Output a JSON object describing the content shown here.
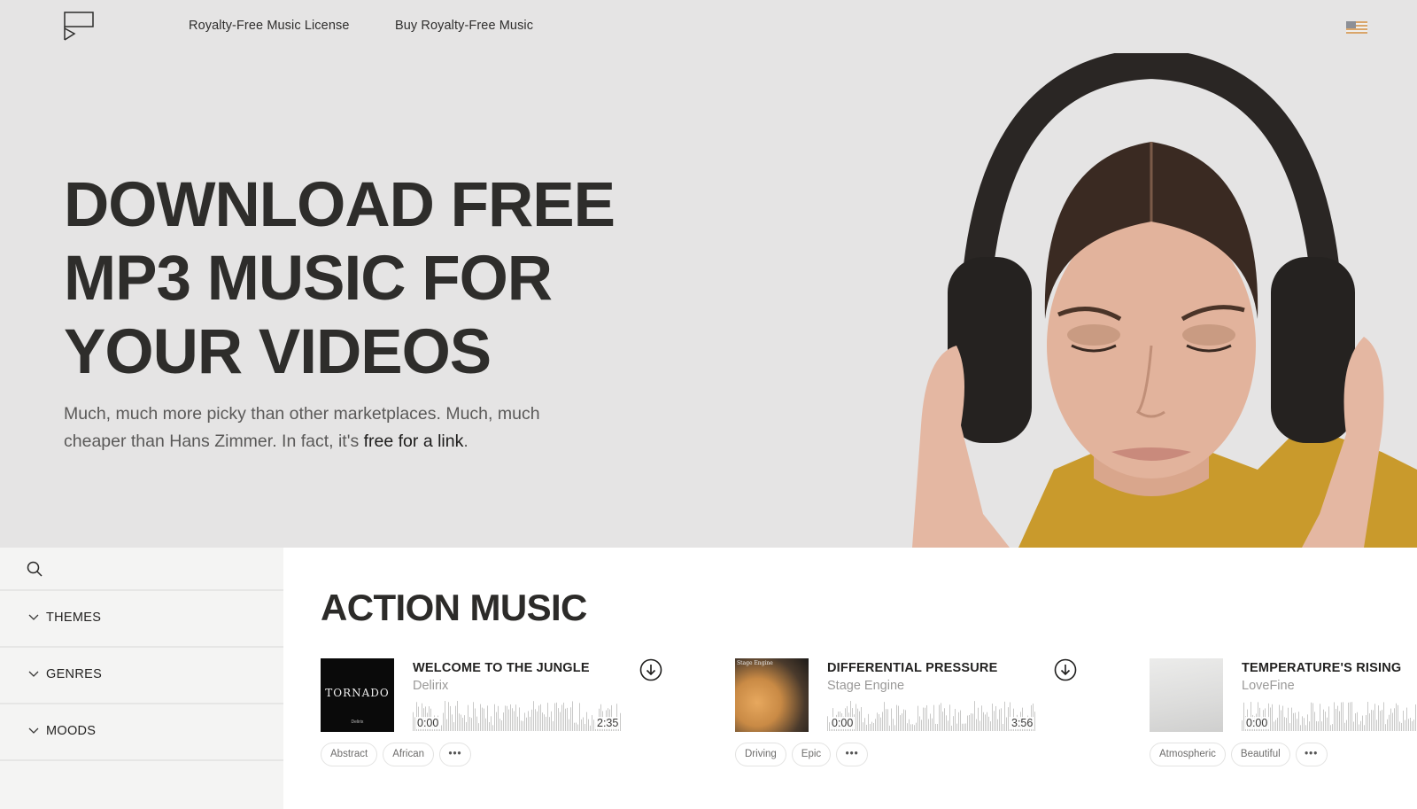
{
  "header": {
    "logo_icon": "flag-play-logo-icon",
    "nav": [
      {
        "label": "Royalty-Free Music License"
      },
      {
        "label": "Buy Royalty-Free Music"
      }
    ],
    "language_icon": "us-flag-icon"
  },
  "hero": {
    "headline_lines": [
      "DOWNLOAD FREE",
      "MP3 MUSIC FOR",
      "YOUR VIDEOS"
    ],
    "subtext_before_link": "Much, much more picky than other marketplaces. Much, much cheaper than Hans Zimmer. In fact, it's ",
    "subtext_link": "free for a link",
    "subtext_after_link": ".",
    "image_alt": "woman-wearing-headphones"
  },
  "sidebar": {
    "search_icon": "search-icon",
    "items": [
      {
        "label": "THEMES",
        "icon": "chevron-down-icon"
      },
      {
        "label": "GENRES",
        "icon": "chevron-down-icon"
      },
      {
        "label": "MOODS",
        "icon": "chevron-down-icon"
      }
    ]
  },
  "main": {
    "section_title": "ACTION MUSIC",
    "tracks": [
      {
        "title": "WELCOME TO THE JUNGLE",
        "artist": "Delirix",
        "current_time": "0:00",
        "duration": "2:35",
        "cover_text": "TORNADO",
        "cover_subtext": "Delirix",
        "tags": [
          "Abstract",
          "African"
        ],
        "more_label": "•••",
        "colors": {
          "cover_bg": "#0a0a0a"
        }
      },
      {
        "title": "DIFFERENTIAL PRESSURE",
        "artist": "Stage Engine",
        "current_time": "0:00",
        "duration": "3:56",
        "cover_text": "Stage Engine",
        "tags": [
          "Driving",
          "Epic"
        ],
        "more_label": "•••",
        "colors": {
          "cover_bg": "#c98a45"
        }
      },
      {
        "title": "TEMPERATURE'S RISING",
        "artist": "LoveFine",
        "current_time": "0:00",
        "duration": "",
        "tags": [
          "Atmospheric",
          "Beautiful"
        ],
        "more_label": "•••",
        "colors": {
          "cover_bg": "#e2e2e1"
        }
      }
    ]
  }
}
